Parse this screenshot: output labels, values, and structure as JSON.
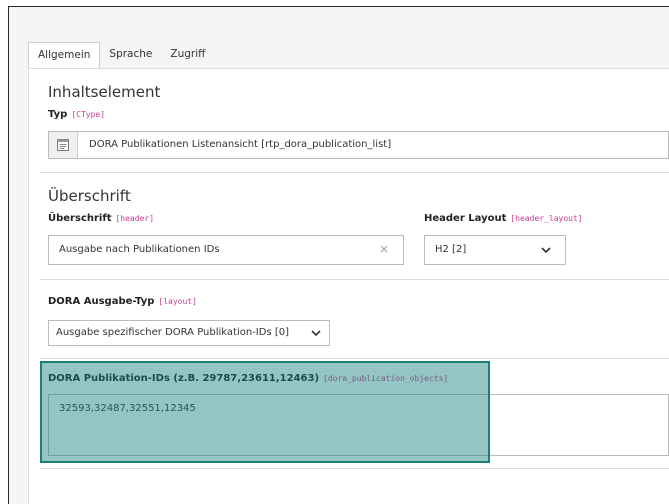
{
  "tabs": [
    {
      "label": "Allgemein",
      "active": true
    },
    {
      "label": "Sprache",
      "active": false
    },
    {
      "label": "Zugriff",
      "active": false
    }
  ],
  "content_element": {
    "section_title": "Inhaltselement",
    "type_label": "Typ",
    "type_code": "[CType]",
    "type_value": "DORA Publikationen Listenansicht [rtp_dora_publication_list]",
    "type_icon": "content-element-icon"
  },
  "header_section": {
    "section_title": "Überschrift",
    "header_label": "Überschrift",
    "header_code": "[header]",
    "header_value": "Ausgabe nach Publikationen IDs",
    "clear_glyph": "×",
    "layout_label": "Header Layout",
    "layout_code": "[header_layout]",
    "layout_value": "H2 [2]"
  },
  "output_type": {
    "label": "DORA Ausgabe-Typ",
    "code": "[layout]",
    "value": "Ausgabe spezifischer DORA Publikation-IDs [0]"
  },
  "publication_ids": {
    "label": "DORA Publikation-IDs (z.B. 29787,23611,12463)",
    "code": "[dora_publication_objects]",
    "value": "32593,32487,32551,12345"
  },
  "colors": {
    "highlight_fill": "#19807c",
    "highlight_border": "#1a7f79",
    "code_color": "#c83c91"
  }
}
